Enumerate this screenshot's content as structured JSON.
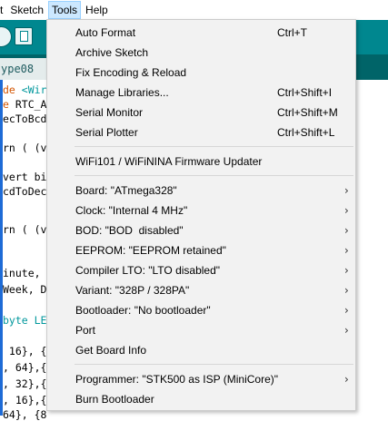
{
  "menubar": {
    "items": [
      {
        "label": "t"
      },
      {
        "label": "Sketch"
      },
      {
        "label": "Tools"
      },
      {
        "label": "Help"
      }
    ]
  },
  "tab": {
    "label": "ype08"
  },
  "editor": {
    "lines": [
      {
        "prefix": "de ",
        "mid": "<Wir",
        "rest": ""
      },
      {
        "prefix": "",
        "mid": "e ",
        "rest": "RTC_A"
      },
      {
        "prefix": "ecToBcd",
        "mid": "",
        "rest": ""
      },
      {
        "prefix": "",
        "mid": "",
        "rest": ""
      },
      {
        "prefix": "rn ( (v",
        "mid": "",
        "rest": ""
      },
      {
        "prefix": "",
        "mid": "",
        "rest": ""
      },
      {
        "prefix": "vert bi",
        "mid": "",
        "rest": ""
      },
      {
        "prefix": "cdToDec",
        "mid": "",
        "rest": ""
      },
      {
        "prefix": "",
        "mid": "",
        "rest": ""
      },
      {
        "prefix": "rn ( (v",
        "mid": "",
        "rest": ""
      },
      {
        "prefix": "",
        "mid": "",
        "rest": ""
      },
      {
        "prefix": "",
        "mid": "",
        "rest": ""
      },
      {
        "prefix": "inute,",
        "mid": "",
        "rest": ""
      },
      {
        "prefix": "Week, D",
        "mid": "",
        "rest": ""
      },
      {
        "prefix": "",
        "mid": "",
        "rest": ""
      },
      {
        "prefix": "byte LE",
        "mid": "",
        "rest": ""
      },
      {
        "prefix": "",
        "mid": "",
        "rest": ""
      },
      {
        "prefix": " 16}, {",
        "mid": "",
        "rest": ""
      },
      {
        "prefix": ", 64},{",
        "mid": "",
        "rest": ""
      },
      {
        "prefix": ", 32},{",
        "mid": "",
        "rest": ""
      },
      {
        "prefix": ", 16},{",
        "mid": "",
        "rest": ""
      },
      {
        "prefix": "64}, {8",
        "mid": "",
        "rest": ""
      }
    ]
  },
  "tools_menu": {
    "items": [
      {
        "label": "Auto Format",
        "shortcut": "Ctrl+T"
      },
      {
        "label": "Archive Sketch",
        "shortcut": ""
      },
      {
        "label": "Fix Encoding & Reload",
        "shortcut": ""
      },
      {
        "label": "Manage Libraries...",
        "shortcut": "Ctrl+Shift+I"
      },
      {
        "label": "Serial Monitor",
        "shortcut": "Ctrl+Shift+M"
      },
      {
        "label": "Serial Plotter",
        "shortcut": "Ctrl+Shift+L"
      },
      {
        "label": "WiFi101 / WiFiNINA Firmware Updater",
        "shortcut": ""
      },
      {
        "label": "Board: \"ATmega328\"",
        "submenu": true
      },
      {
        "label": "Clock: \"Internal 4 MHz\"",
        "submenu": true
      },
      {
        "label": "BOD: \"BOD  disabled\"",
        "submenu": true
      },
      {
        "label": "EEPROM: \"EEPROM retained\"",
        "submenu": true
      },
      {
        "label": "Compiler LTO: \"LTO disabled\"",
        "submenu": true
      },
      {
        "label": "Variant: \"328P / 328PA\"",
        "submenu": true
      },
      {
        "label": "Bootloader: \"No bootloader\"",
        "submenu": true
      },
      {
        "label": "Port",
        "submenu": true
      },
      {
        "label": "Get Board Info"
      },
      {
        "label": "Programmer: \"STK500 as ISP (MiniCore)\"",
        "submenu": true
      },
      {
        "label": "Burn Bootloader"
      }
    ],
    "submenu_arrow": "›"
  },
  "colors": {
    "toolbar": "#00878f",
    "tabstrip": "#006468",
    "menu_bg": "#f2f2f2",
    "menubar_active": "#cce8ff"
  }
}
